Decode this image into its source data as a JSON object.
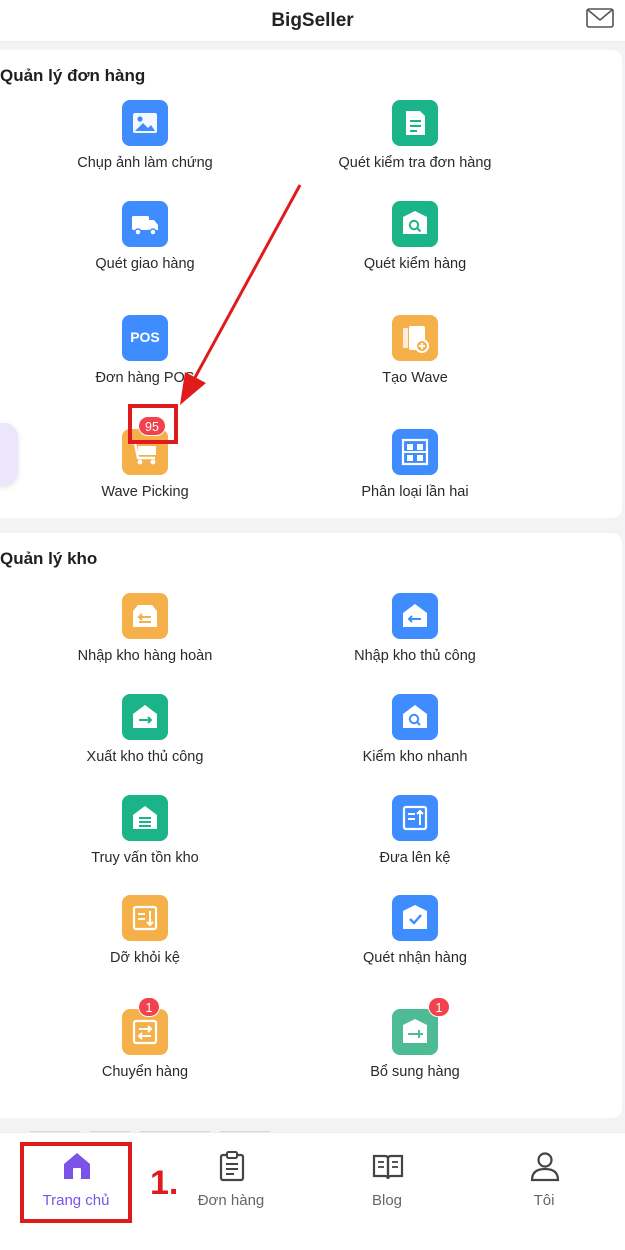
{
  "header": {
    "title": "BigSeller",
    "mail_icon": "mail-icon"
  },
  "orders": {
    "title": "Quản lý đơn hàng",
    "items": [
      {
        "label": "Chụp ảnh làm chứng",
        "icon": "image-icon",
        "color": "#3f8cff"
      },
      {
        "label": "Quét kiểm tra đơn hàng",
        "icon": "document-check-icon",
        "color": "#1bb489"
      },
      {
        "label": "Quét giao hàng",
        "icon": "truck-icon",
        "color": "#3f8cff"
      },
      {
        "label": "Quét kiểm hàng",
        "icon": "box-search-icon",
        "color": "#1bb489"
      },
      {
        "label": "Đơn hàng POS",
        "icon_text": "POS",
        "icon": "pos-icon",
        "color": "#3f8cff"
      },
      {
        "label": "Tạo Wave",
        "icon": "wave-create-icon",
        "color": "#f5b04a"
      },
      {
        "label": "Wave Picking",
        "icon": "cart-icon",
        "color": "#f5b04a",
        "badge": "95"
      },
      {
        "label": "Phân loại lần hai",
        "icon": "shelf-icon",
        "color": "#3f8cff"
      }
    ]
  },
  "warehouse": {
    "title": "Quản lý kho",
    "items": [
      {
        "label": "Nhập kho hàng hoàn",
        "icon": "return-inbound-icon",
        "color": "#f5b04a"
      },
      {
        "label": "Nhập kho thủ công",
        "icon": "manual-inbound-icon",
        "color": "#3f8cff"
      },
      {
        "label": "Xuất kho thủ công",
        "icon": "manual-outbound-icon",
        "color": "#1bb489"
      },
      {
        "label": "Kiểm kho nhanh",
        "icon": "quick-stocktake-icon",
        "color": "#3f8cff"
      },
      {
        "label": "Truy vấn tồn kho",
        "icon": "inventory-query-icon",
        "color": "#1bb489"
      },
      {
        "label": "Đưa lên kệ",
        "icon": "shelve-up-icon",
        "color": "#3f8cff"
      },
      {
        "label": "Dỡ khỏi kệ",
        "icon": "shelve-down-icon",
        "color": "#f5b04a"
      },
      {
        "label": "Quét nhận hàng",
        "icon": "receive-scan-icon",
        "color": "#3f8cff"
      },
      {
        "label": "Chuyển hàng",
        "icon": "transfer-icon",
        "color": "#f5b04a",
        "badge": "1"
      },
      {
        "label": "Bổ sung hàng",
        "icon": "replenish-icon",
        "color": "#4dbb94",
        "badge": "1"
      }
    ]
  },
  "tabs": [
    {
      "label": "Trang chủ",
      "icon": "home-icon",
      "active": true
    },
    {
      "label": "Đơn hàng",
      "icon": "orders-icon"
    },
    {
      "label": "Blog",
      "icon": "book-icon"
    },
    {
      "label": "Tôi",
      "icon": "user-icon"
    }
  ],
  "annotation": {
    "step": "1.",
    "highlight_color": "#e01b1b"
  },
  "colors": {
    "accent": "#7b53e8",
    "badge": "#f2424e"
  }
}
